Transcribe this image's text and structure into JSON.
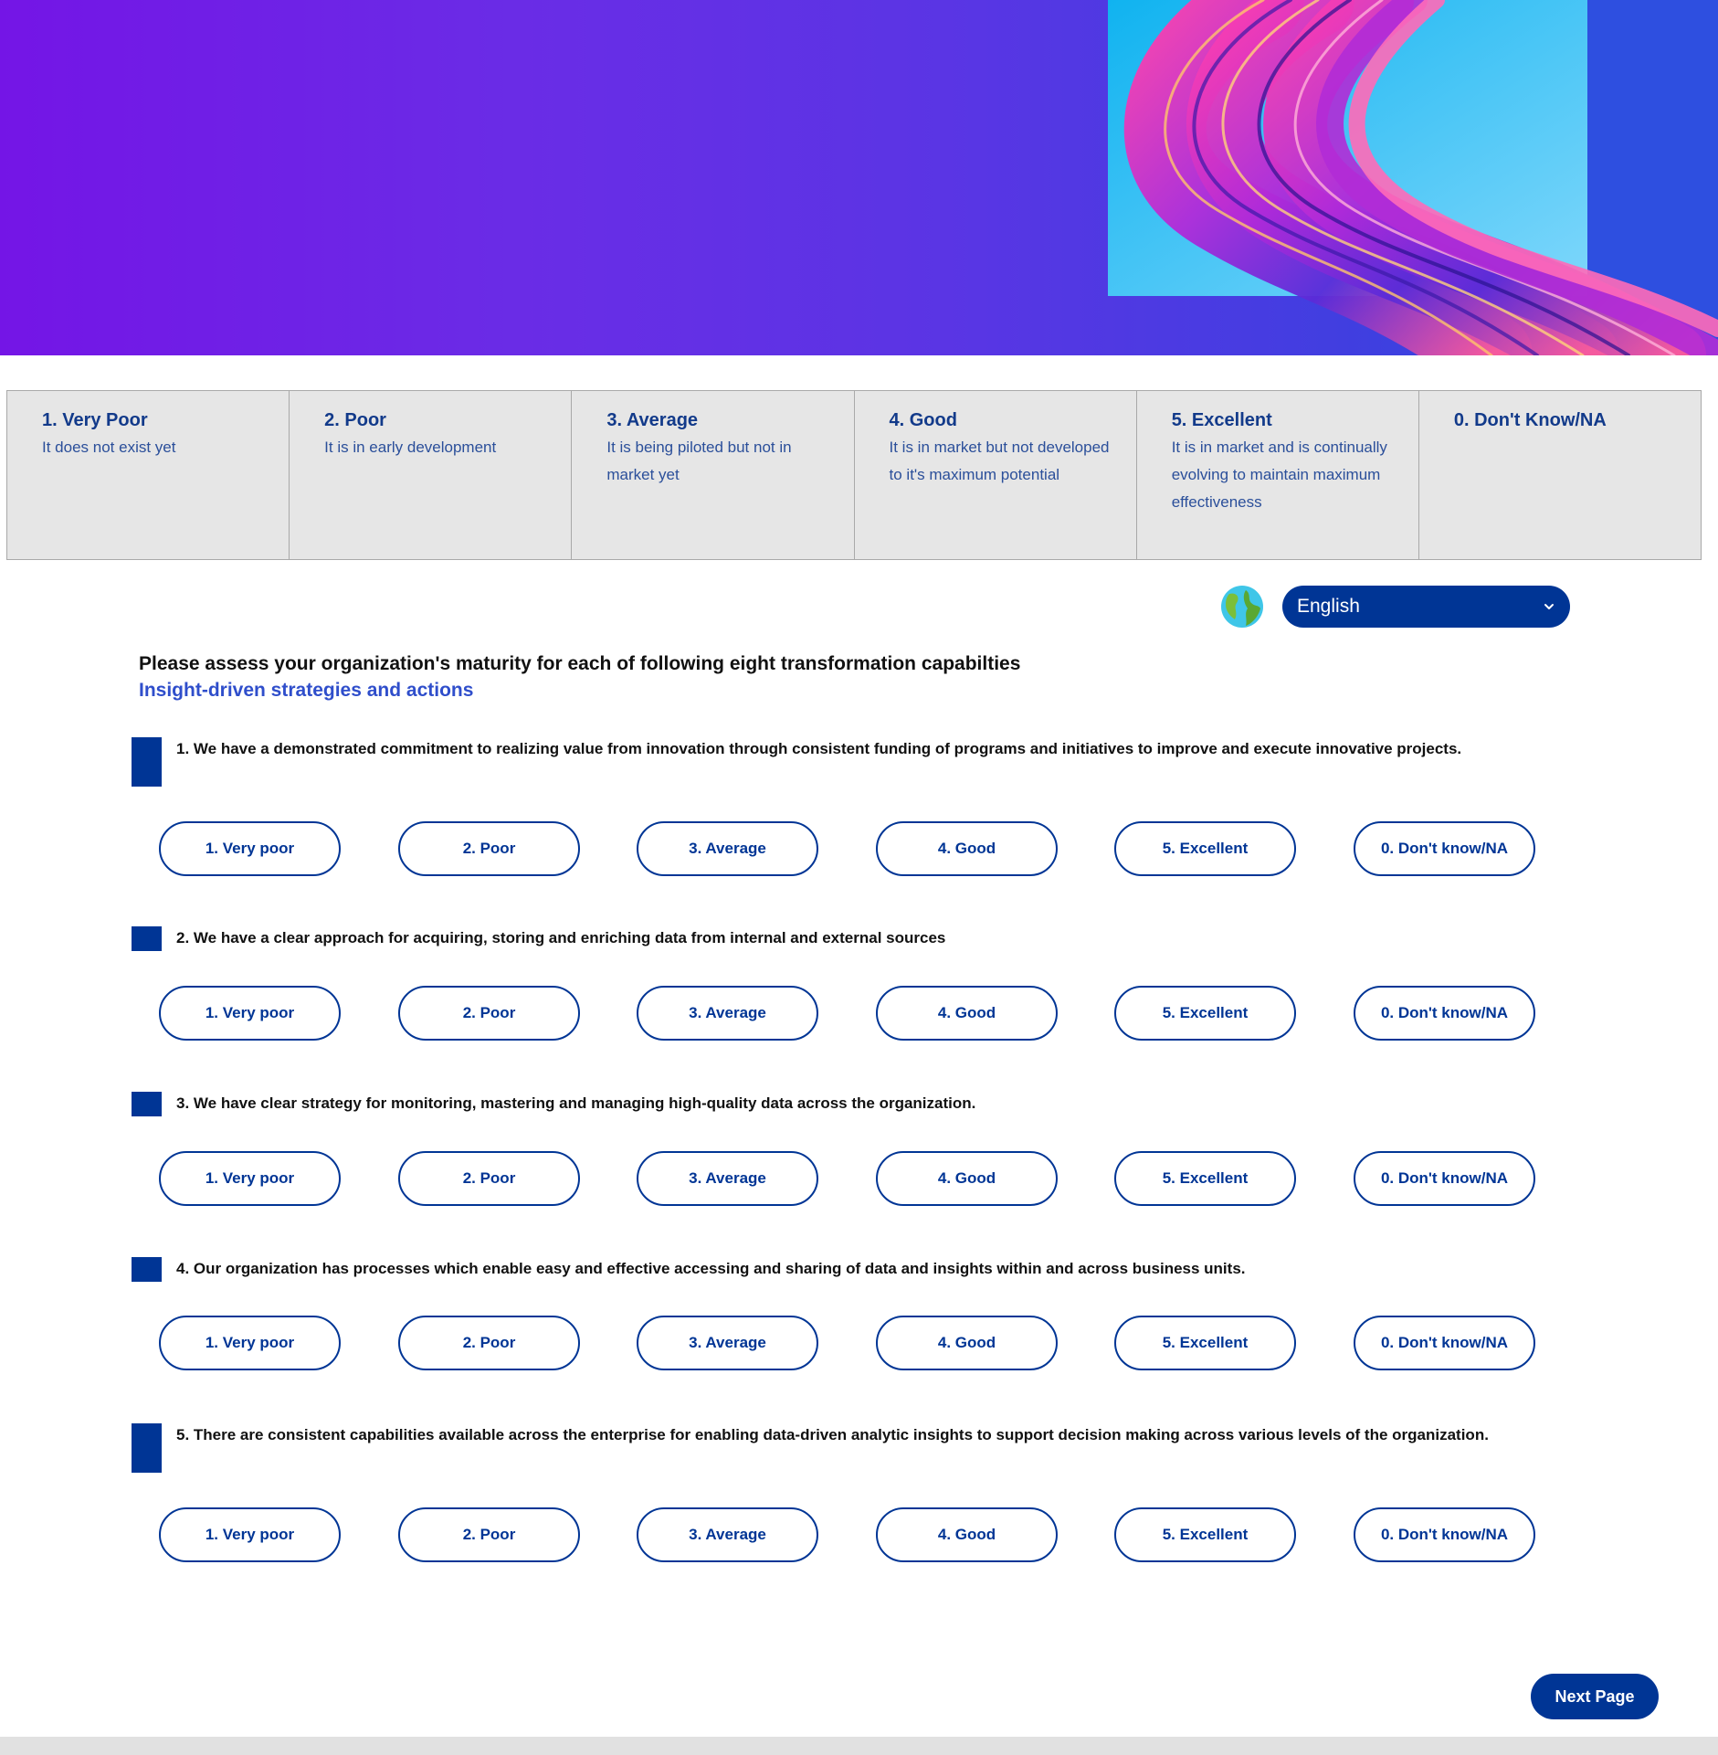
{
  "legend": [
    {
      "title": "1. Very Poor",
      "desc": "It does not exist yet"
    },
    {
      "title": "2. Poor",
      "desc": "It is in early development"
    },
    {
      "title": "3. Average",
      "desc": "It is being piloted but not in market yet"
    },
    {
      "title": "4. Good",
      "desc": "It is in market but not developed to it's maximum potential"
    },
    {
      "title": "5. Excellent",
      "desc": "It is in market and is continually evolving to maintain maximum effectiveness"
    },
    {
      "title": "0. Don't Know/NA",
      "desc": ""
    }
  ],
  "language": {
    "selected": "English",
    "icon": "globe-icon"
  },
  "intro": {
    "question": "Please assess your organization's maturity for each of following eight transformation capabilties",
    "section": "Insight-driven strategies and actions"
  },
  "options": [
    "1. Very poor",
    "2. Poor",
    "3. Average",
    "4. Good",
    "5. Excellent",
    "0. Don't know/NA"
  ],
  "questions": [
    {
      "text": "1. We have a demonstrated commitment to realizing value from innovation through consistent funding of programs and initiatives to improve and execute innovative projects."
    },
    {
      "text": "2. We have a clear approach for acquiring, storing and enriching data from internal and external sources"
    },
    {
      "text": "3. We have clear strategy for monitoring, mastering and managing high-quality data across the organization."
    },
    {
      "text": "4. Our organization has processes which enable easy and effective accessing and sharing of data and insights within and across business units."
    },
    {
      "text": "5. There are consistent capabilities available across the enterprise for enabling data-driven analytic insights to support decision making across various levels of the organization."
    }
  ],
  "footer": {
    "next_label": "Next Page"
  },
  "colors": {
    "accent": "#003595",
    "section_title": "#2f4ecb",
    "legend_bg": "#e6e6e6"
  }
}
